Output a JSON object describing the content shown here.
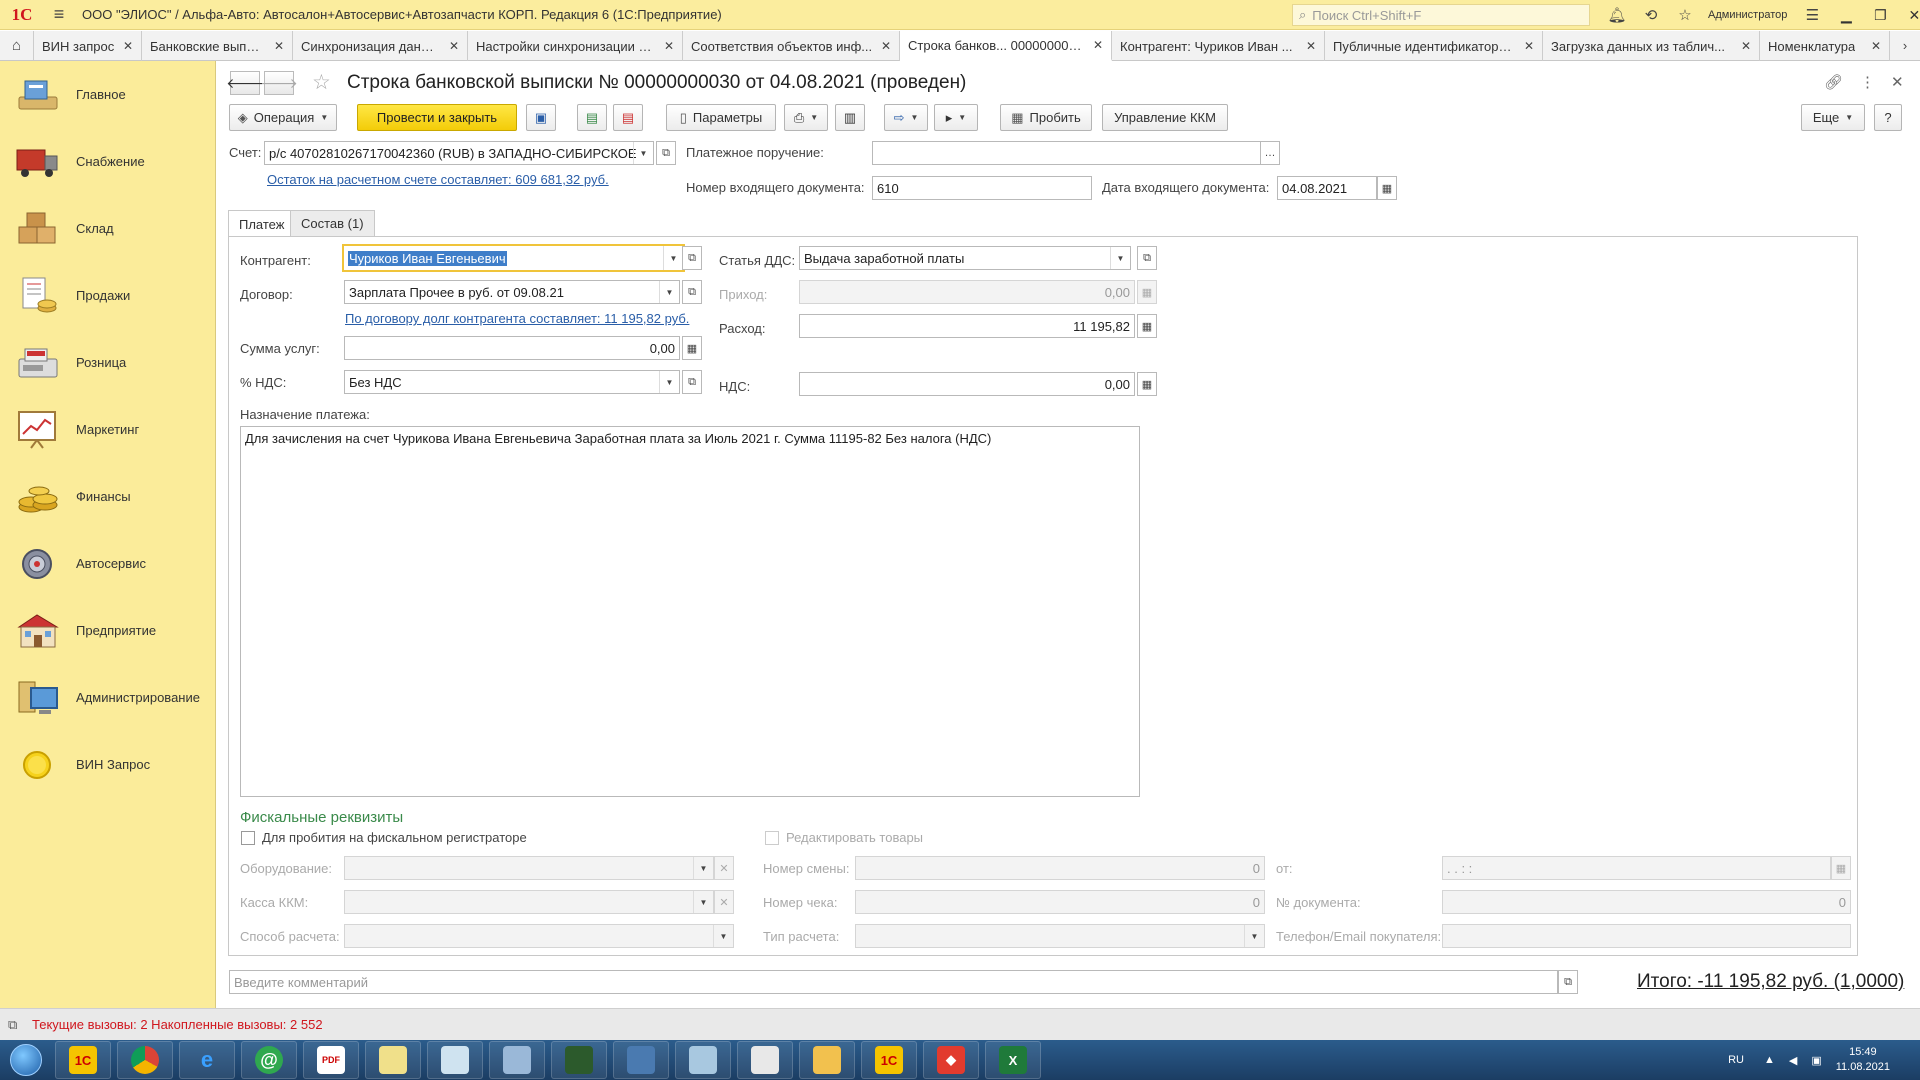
{
  "titlebar": {
    "logo": "1С",
    "title": "ООО \"ЭЛИОС\" / Альфа-Авто: Автосалон+Автосервис+Автозапчасти КОРП. Редакция 6  (1С:Предприятие)",
    "search_placeholder": "Поиск Ctrl+Shift+F",
    "user": "Администратор"
  },
  "tabs": [
    {
      "label": "ВИН запрос"
    },
    {
      "label": "Банковские выписки"
    },
    {
      "label": "Синхронизация данных"
    },
    {
      "label": "Настройки синхронизации д..."
    },
    {
      "label": "Соответствия объектов инф..."
    },
    {
      "label": "Строка банков... 00000000030"
    },
    {
      "label": "Контрагент: Чуриков Иван ..."
    },
    {
      "label": "Публичные идентификаторы..."
    },
    {
      "label": "Загрузка данных из таблич..."
    },
    {
      "label": "Номенклатура"
    }
  ],
  "sidebar": {
    "items": [
      {
        "label": "Главное",
        "icon": "home-icon"
      },
      {
        "label": "Снабжение",
        "icon": "truck-icon"
      },
      {
        "label": "Склад",
        "icon": "boxes-icon"
      },
      {
        "label": "Продажи",
        "icon": "sales-icon"
      },
      {
        "label": "Розница",
        "icon": "cash-register-icon"
      },
      {
        "label": "Маркетинг",
        "icon": "chart-board-icon"
      },
      {
        "label": "Финансы",
        "icon": "coins-icon"
      },
      {
        "label": "Автосервис",
        "icon": "gear-icon"
      },
      {
        "label": "Предприятие",
        "icon": "building-icon"
      },
      {
        "label": "Администрирование",
        "icon": "computer-icon"
      },
      {
        "label": "ВИН Запрос",
        "icon": "yellow-circle-icon"
      }
    ]
  },
  "form": {
    "title": "Строка банковской выписки № 00000000030 от 04.08.2021 (проведен)",
    "toolbar": {
      "operation": "Операция",
      "post_close": "Провести и закрыть",
      "params": "Параметры",
      "punch": "Пробить",
      "kkm": "Управление ККМ",
      "more": "Еще",
      "help": "?"
    },
    "account_label": "Счет:",
    "account_value": "р/с 40702810267170042360 (RUB) в ЗАПАДНО-СИБИРСКОЕ",
    "balance_link": "Остаток на расчетном счете составляет: 609 681,32 руб.",
    "payment_order_label": "Платежное поручение:",
    "payment_order_value": "",
    "incoming_num_label": "Номер входящего документа:",
    "incoming_num_value": "610",
    "incoming_date_label": "Дата входящего документа:",
    "incoming_date_value": "04.08.2021",
    "tab_payment": "Платеж",
    "tab_composition": "Состав (1)",
    "counterparty_label": "Контрагент:",
    "counterparty_value": "Чуриков Иван Евгеньевич",
    "contract_label": "Договор:",
    "contract_value": "Зарплата Прочее в руб. от 09.08.21",
    "debt_link": "По договору долг контрагента составляет: 11 195,82 руб.",
    "services_label": "Сумма услуг:",
    "services_value": "0,00",
    "vat_rate_label": "% НДС:",
    "vat_rate_value": "Без НДС",
    "dds_label": "Статья ДДС:",
    "dds_value": "Выдача заработной платы",
    "income_label": "Приход:",
    "income_value": "0,00",
    "expense_label": "Расход:",
    "expense_value": "11 195,82",
    "vat_label": "НДС:",
    "vat_value": "0,00",
    "purpose_label": "Назначение платежа:",
    "purpose_value": "Для зачисления на счет Чурикова Ивана Евгеньевича Заработная плата за Июль 2021 г. Сумма 11195-82 Без налога (НДС)",
    "fiscal_title": "Фискальные реквизиты",
    "fiscal_checkbox": "Для пробития на фискальном регистраторе",
    "edit_goods": "Редактировать товары",
    "equipment_label": "Оборудование:",
    "kkm_label": "Касса ККМ:",
    "pay_method_label": "Способ расчета:",
    "shift_label": "Номер смены:",
    "shift_value": "0",
    "check_label": "Номер чека:",
    "check_value": "0",
    "calc_type_label": "Тип расчета:",
    "from_label": "от:",
    "from_value": ".  .     :  :",
    "doc_no_label": "№ документа:",
    "doc_no_value": "0",
    "phone_label": "Телефон/Email покупателя:",
    "comment_placeholder": "Введите комментарий",
    "total": "Итого: -11 195,82 руб. (1,0000)"
  },
  "statusbar": {
    "text": "Текущие вызовы: 2   Накопленные вызовы: 2 552"
  },
  "taskbar": {
    "lang": "RU",
    "time": "15:49",
    "date": "11.08.2021"
  },
  "colors": {
    "sidebar": "#fbec9a",
    "primary_button": "#f7d51b",
    "link": "#2a5ea8",
    "status_red": "#d0171e",
    "fiscal_green": "#3a8a4a"
  }
}
